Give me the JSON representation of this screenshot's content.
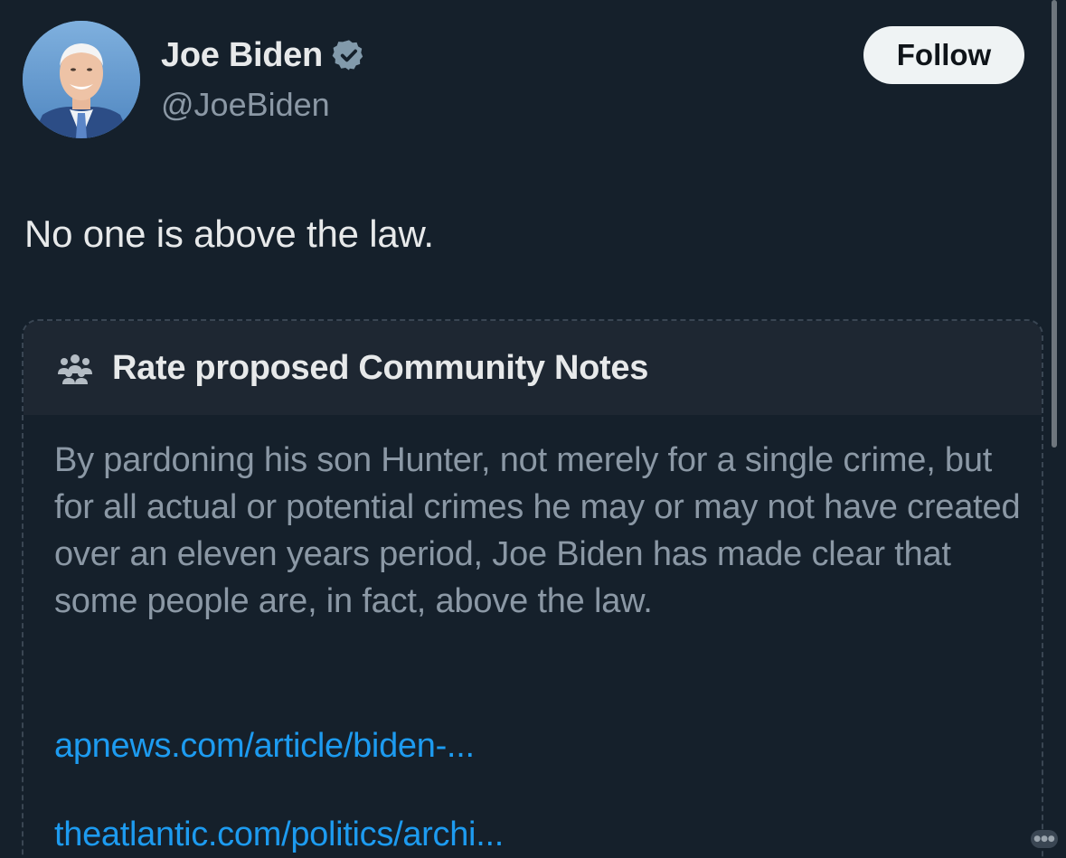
{
  "profile": {
    "display_name": "Joe Biden",
    "handle": "@JoeBiden",
    "verified": true,
    "avatar_icon": "profile-photo"
  },
  "actions": {
    "follow_label": "Follow"
  },
  "tweet": {
    "text": "No one is above the law."
  },
  "community_notes": {
    "icon": "people-icon",
    "title": "Rate proposed Community Notes",
    "note_text": "By pardoning his son Hunter, not merely for a single crime, but for all actual or potential crimes he may or may not have created over an eleven years period, Joe Biden has made clear that some people are, in fact, above the law.",
    "links": [
      "apnews.com/article/biden-...",
      "theatlantic.com/politics/archi..."
    ]
  },
  "colors": {
    "background": "#15202b",
    "header_band": "#1e2732",
    "primary_text": "#e7e9ea",
    "secondary_text": "#8b98a5",
    "link": "#1d9bf0",
    "verified_badge": "#829aab"
  }
}
